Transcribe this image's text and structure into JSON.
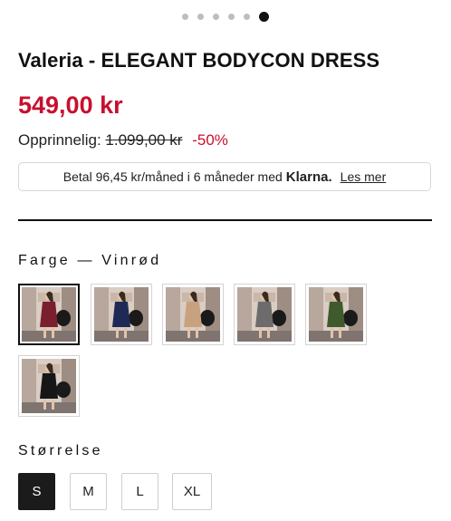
{
  "carousel": {
    "count": 6,
    "active_index": 5
  },
  "product": {
    "title": "Valeria - ELEGANT BODYCON DRESS",
    "price": "549,00 kr",
    "original_label": "Opprinnelig:",
    "original_price": "1.099,00 kr",
    "discount": "-50%"
  },
  "klarna": {
    "text": "Betal 96,45 kr/måned i 6 måneder med",
    "brand": "Klarna.",
    "link": "Les mer"
  },
  "color": {
    "label": "Farge — Vinrød",
    "selected_index": 0,
    "swatches": [
      {
        "name": "wine",
        "color": "#7a1f2e"
      },
      {
        "name": "navy",
        "color": "#1e2a55"
      },
      {
        "name": "beige",
        "color": "#c8a27e"
      },
      {
        "name": "grey",
        "color": "#6c6c6c"
      },
      {
        "name": "green",
        "color": "#3f5a2c"
      },
      {
        "name": "black",
        "color": "#161616"
      }
    ]
  },
  "size": {
    "label": "Størrelse",
    "selected": "S",
    "options": [
      "S",
      "M",
      "L",
      "XL"
    ]
  }
}
